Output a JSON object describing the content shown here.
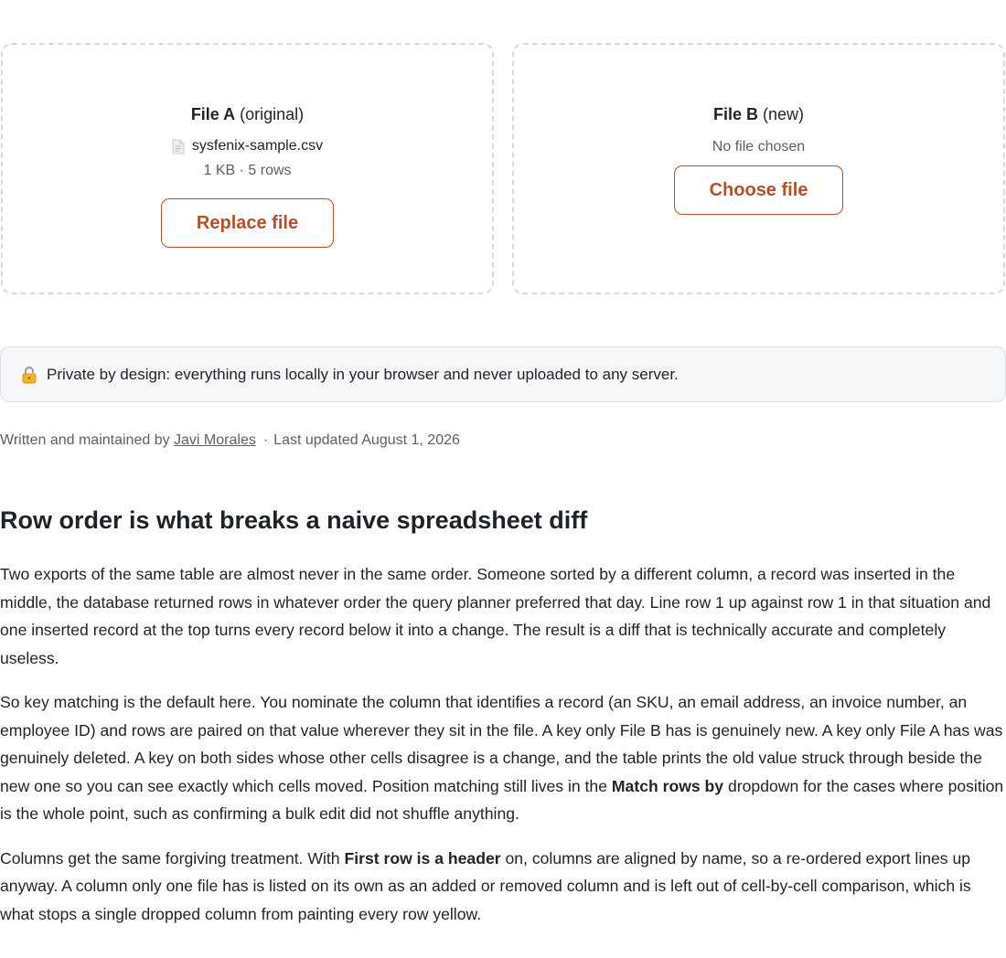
{
  "file_a": {
    "title_bold": "File A",
    "title_rest": " (original)",
    "file_name": "sysfenix-sample.csv",
    "file_meta": "1 KB · 5 rows",
    "button_label": "Replace file"
  },
  "file_b": {
    "title_bold": "File B",
    "title_rest": " (new)",
    "status": "No file chosen",
    "button_label": "Choose file"
  },
  "privacy": {
    "icon": "lock-icon",
    "text": "Private by design: everything runs locally in your browser and never uploaded to any server."
  },
  "byline": {
    "prefix": "Written and maintained by ",
    "author": "Javi Morales",
    "separator": "·",
    "updated": "Last updated August 1, 2026"
  },
  "article": {
    "heading": "Row order is what breaks a naive spreadsheet diff",
    "p1": "Two exports of the same table are almost never in the same order. Someone sorted by a different column, a record was inserted in the middle, the database returned rows in whatever order the query planner preferred that day. Line row 1 up against row 1 in that situation and one inserted record at the top turns every record below it into a change. The result is a diff that is technically accurate and completely useless.",
    "p2_a": "So key matching is the default here. You nominate the column that identifies a record (an SKU, an email address, an invoice number, an employee ID) and rows are paired on that value wherever they sit in the file. A key only File B has is genuinely new. A key only File A has was genuinely deleted. A key on both sides whose other cells disagree is a change, and the table prints the old value struck through beside the new one so you can see exactly which cells moved. Position matching still lives in the ",
    "p2_bold": "Match rows by",
    "p2_b": " dropdown for the cases where position is the whole point, such as confirming a bulk edit did not shuffle anything.",
    "p3_a": "Columns get the same forgiving treatment. With ",
    "p3_bold": "First row is a header",
    "p3_b": " on, columns are aligned by name, so a re-ordered export lines up anyway. A column only one file has is listed on its own as an added or removed column and is left out of cell-by-cell comparison, which is what stops a single dropped column from painting every row yellow."
  },
  "colors": {
    "accent": "#b5502a",
    "muted_text": "#5b6167",
    "dropzone_border": "#d7d9dc",
    "notice_bg": "#f6f7f8"
  }
}
